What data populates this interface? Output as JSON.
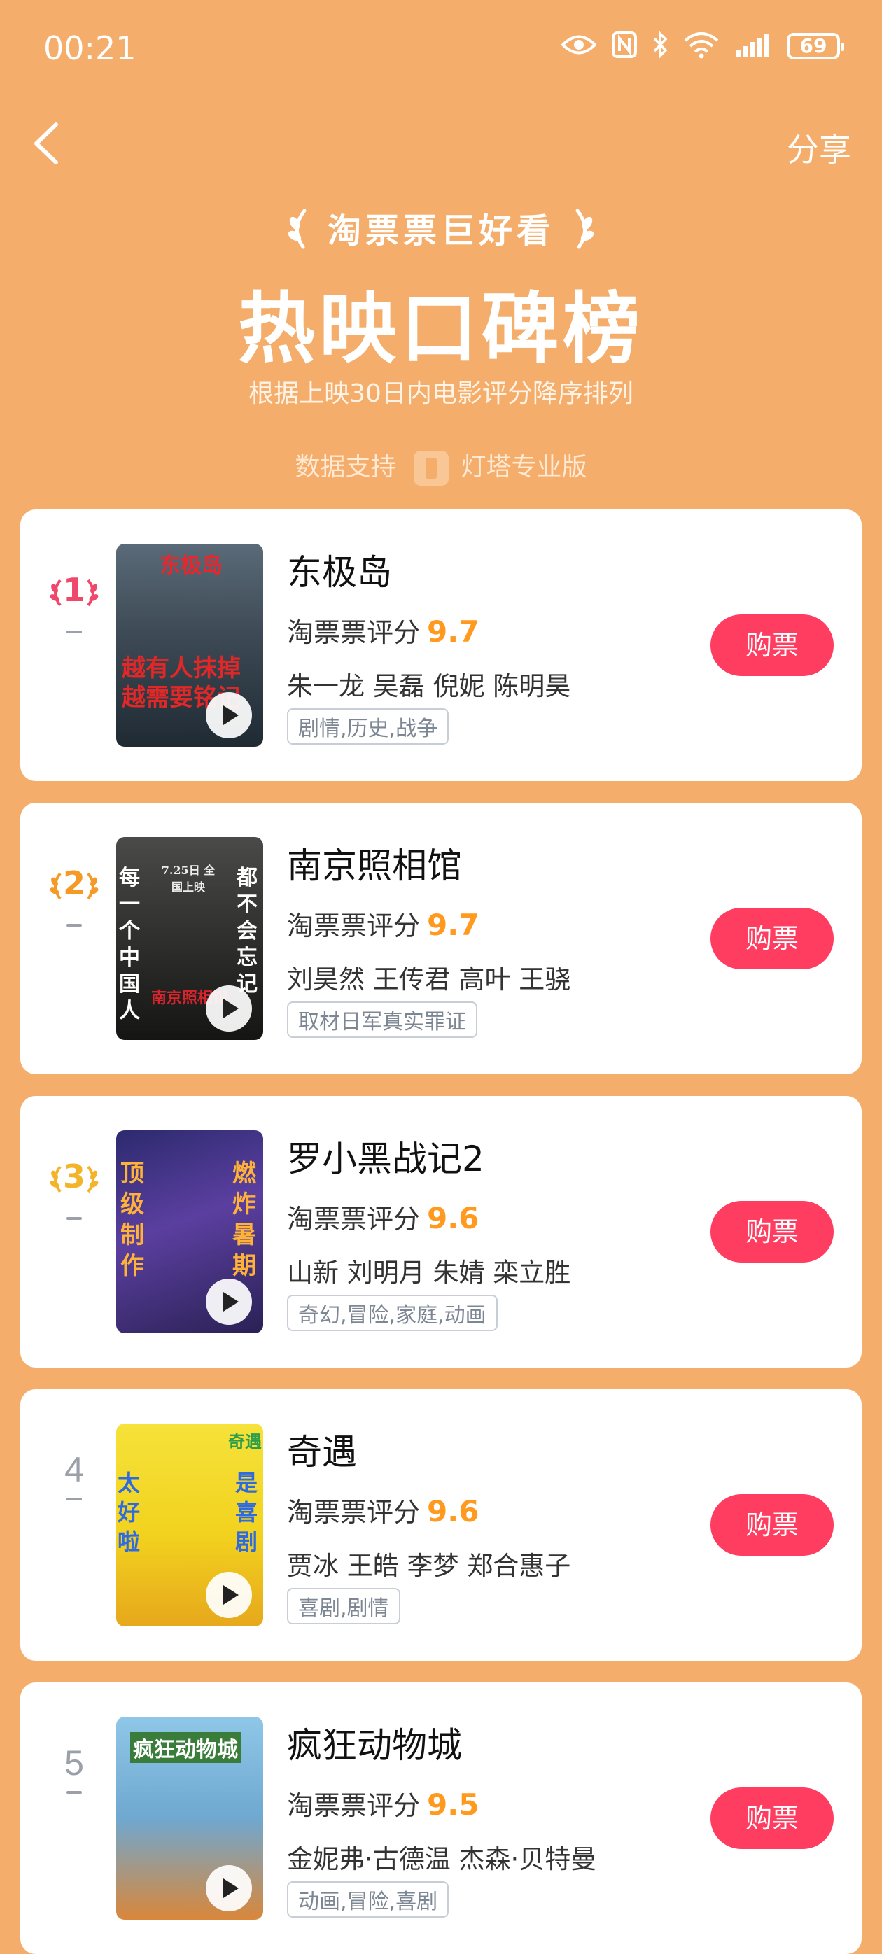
{
  "status_bar": {
    "time": "00:21",
    "battery": "69"
  },
  "header": {
    "share_label": "分享",
    "brand": "淘票票巨好看",
    "title": "热映口碑榜",
    "subtitle": "根据上映30日内电影评分降序排列",
    "data_support_label": "数据支持",
    "data_support_brand": "灯塔专业版"
  },
  "colors": {
    "background": "#F4AD6A",
    "buy_button": "#FF3D60",
    "score": "#FF9A1F",
    "rank1": "#F0486A",
    "rank2": "#F59A26",
    "rank3": "#F3B42A"
  },
  "rating_label": "淘票票评分",
  "buy_label": "购票",
  "movies": [
    {
      "rank": "1",
      "title": "东极岛",
      "score": "9.7",
      "cast": "朱一龙 吴磊 倪妮 陈明昊",
      "genre": "剧情,历史,战争",
      "poster_text": [
        "东极岛",
        "越有人抹掉",
        "越需要铭记"
      ]
    },
    {
      "rank": "2",
      "title": "南京照相馆",
      "score": "9.7",
      "cast": "刘昊然 王传君 高叶 王骁",
      "genre": "取材日军真实罪证",
      "poster_text": [
        "每一个中国人",
        "都不会忘记",
        "7.25日 全国上映",
        "南京照相馆"
      ]
    },
    {
      "rank": "3",
      "title": "罗小黑战记2",
      "score": "9.6",
      "cast": "山新 刘明月 朱婧 栾立胜",
      "genre": "奇幻,冒险,家庭,动画",
      "poster_text": [
        "顶级制作",
        "燃炸暑期"
      ]
    },
    {
      "rank": "4",
      "title": "奇遇",
      "score": "9.6",
      "cast": "贾冰 王皓 李梦 郑合惠子",
      "genre": "喜剧,剧情",
      "poster_text": [
        "太好啦",
        "是喜剧",
        "奇遇"
      ]
    },
    {
      "rank": "5",
      "title": "疯狂动物城",
      "score": "9.5",
      "cast": "金妮弗·古德温 杰森·贝特曼",
      "genre": "动画,冒险,喜剧",
      "poster_text": [
        "疯狂动物城"
      ]
    }
  ]
}
